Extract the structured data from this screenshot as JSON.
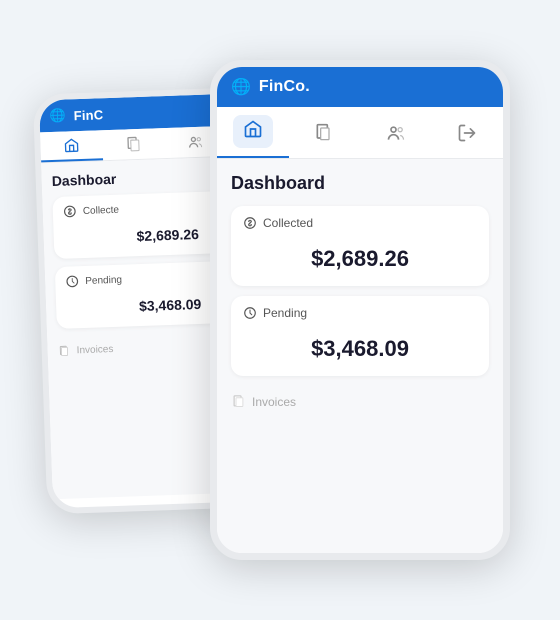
{
  "app": {
    "name": "FinCo.",
    "logo_symbol": "🌐"
  },
  "nav": {
    "items": [
      {
        "id": "home",
        "label": "Home",
        "active": true
      },
      {
        "id": "documents",
        "label": "Documents",
        "active": false
      },
      {
        "id": "users",
        "label": "Users",
        "active": false
      },
      {
        "id": "logout",
        "label": "Logout",
        "active": false
      }
    ]
  },
  "dashboard": {
    "title": "Dashboard",
    "cards": [
      {
        "id": "collected",
        "icon": "dollar-circle",
        "label": "Collected",
        "amount": "$2,689.26"
      },
      {
        "id": "pending",
        "icon": "clock",
        "label": "Pending",
        "amount": "$3,468.09"
      }
    ],
    "invoices_label": "Invoices"
  },
  "colors": {
    "brand": "#1a6fd4",
    "text_primary": "#1a1a2e",
    "text_secondary": "#555555",
    "text_muted": "#aaaaaa",
    "background": "#f7f8fa",
    "card_bg": "#ffffff"
  }
}
